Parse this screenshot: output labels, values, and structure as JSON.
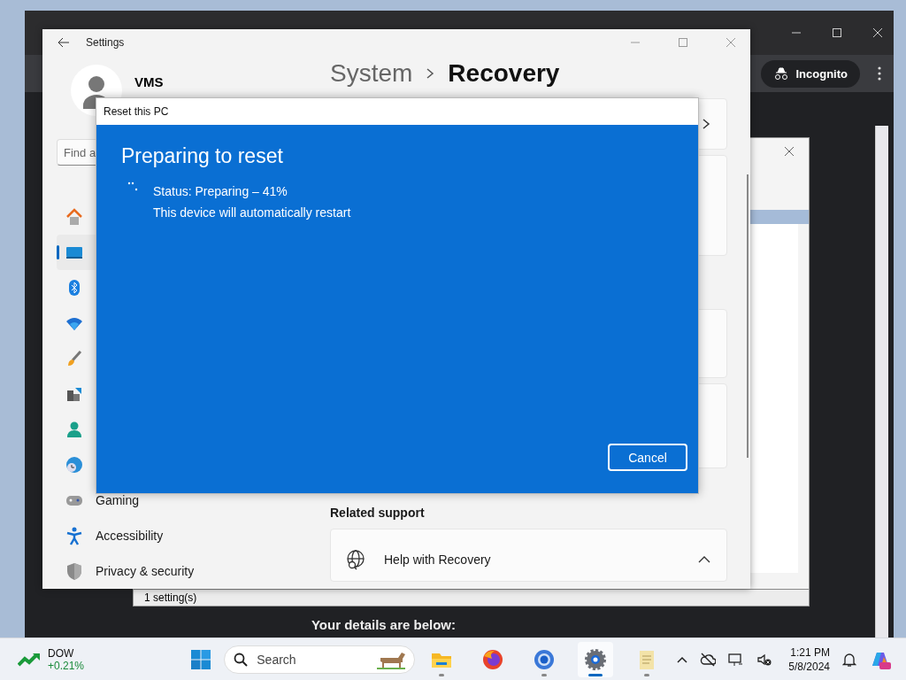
{
  "browser": {
    "incognito_label": "Incognito",
    "page_text": "Your details are below:"
  },
  "back_window": {
    "status_bar": "1 setting(s)"
  },
  "settings": {
    "title": "Settings",
    "user_name": "VMS",
    "breadcrumb": [
      "System",
      "Recovery"
    ],
    "search": {
      "placeholder": "Find a"
    },
    "nav": [
      {
        "kind": "home",
        "selected": false
      },
      {
        "kind": "system",
        "selected": true
      },
      {
        "kind": "bluetooth",
        "selected": false
      },
      {
        "kind": "network",
        "selected": false
      },
      {
        "kind": "personalization",
        "selected": false
      },
      {
        "kind": "apps",
        "selected": false
      },
      {
        "kind": "accounts",
        "selected": false
      },
      {
        "kind": "time",
        "selected": false
      },
      {
        "kind": "gaming",
        "label": "Gaming",
        "selected": false
      },
      {
        "kind": "accessibility",
        "label": "Accessibility",
        "selected": false
      },
      {
        "kind": "privacy",
        "label": "Privacy & security",
        "selected": false
      }
    ],
    "section_title": "Related support",
    "help_item": {
      "label": "Help with Recovery",
      "expanded": true
    }
  },
  "dialog": {
    "title": "Reset this PC",
    "heading": "Preparing to reset",
    "status": "Status: Preparing – 41%",
    "note": "This device will automatically restart",
    "cancel": "Cancel"
  },
  "taskbar": {
    "stock": {
      "name": "DOW",
      "change": "+0.21%"
    },
    "search_placeholder": "Search",
    "apps": [
      {
        "kind": "explorer",
        "running": true,
        "selected": false
      },
      {
        "kind": "firefox",
        "running": false,
        "selected": false
      },
      {
        "kind": "chrome",
        "running": true,
        "selected": false
      },
      {
        "kind": "settings",
        "running": true,
        "selected": true
      },
      {
        "kind": "notepad",
        "running": true,
        "selected": false
      }
    ],
    "time": "1:21 PM",
    "date": "5/8/2024"
  }
}
